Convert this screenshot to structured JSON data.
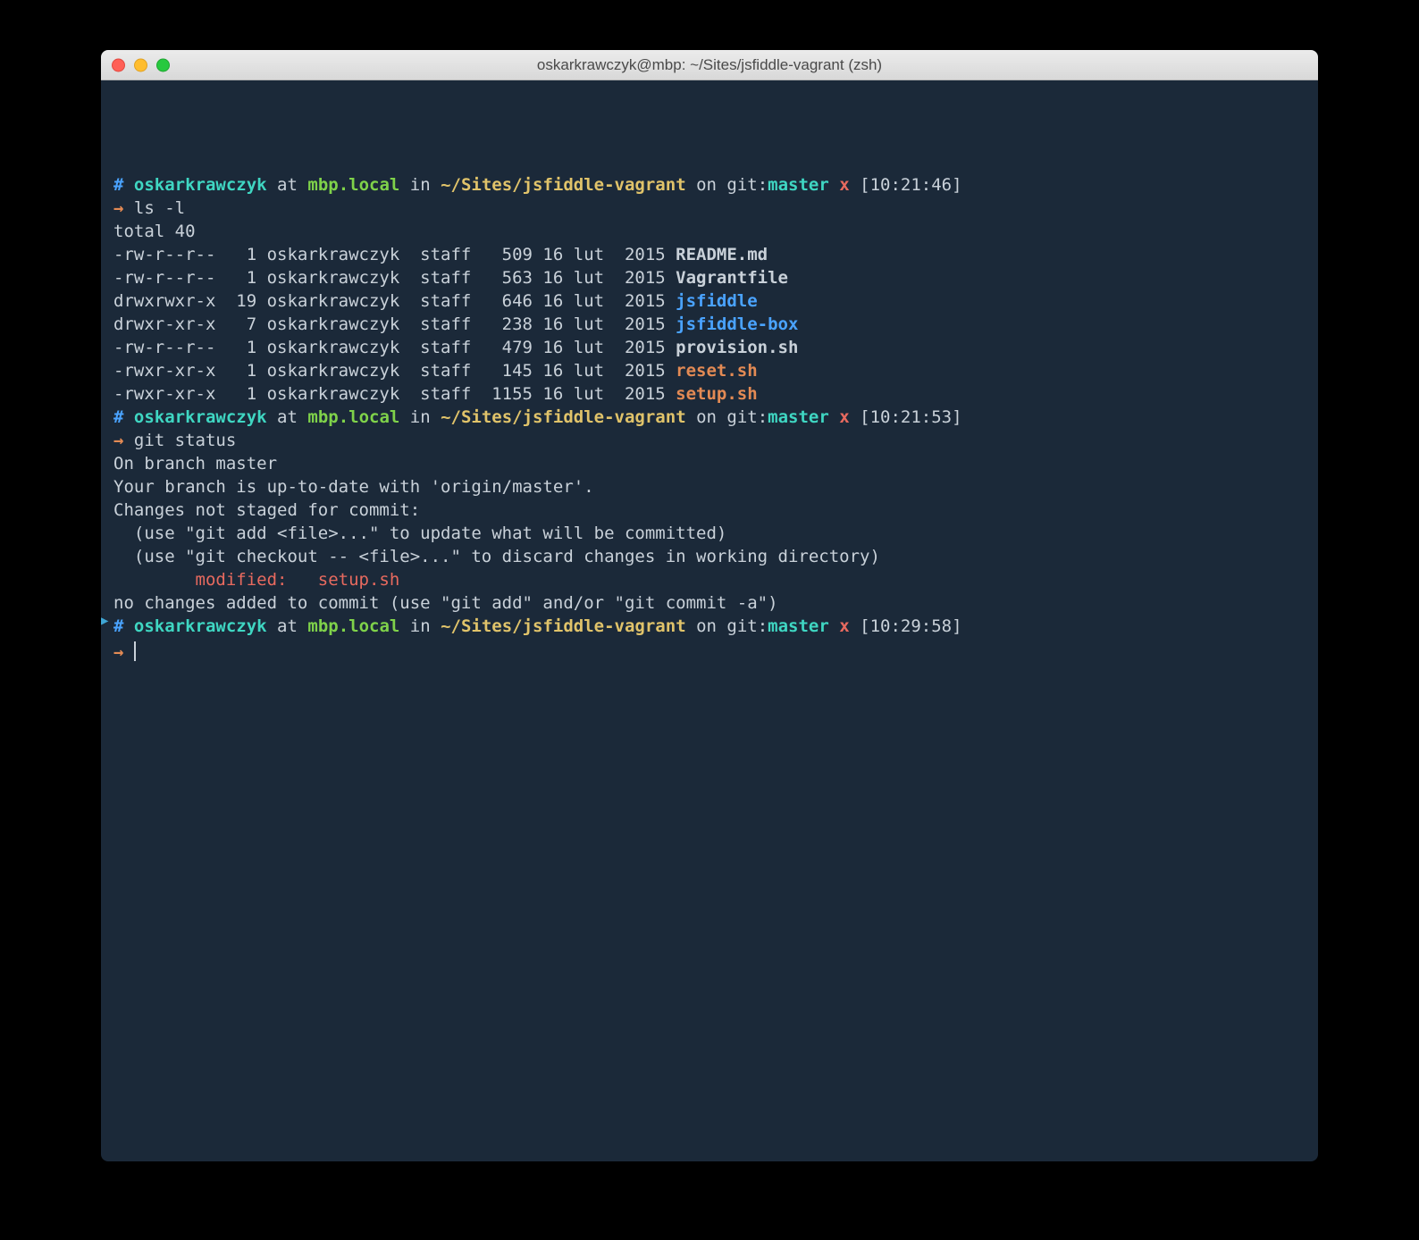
{
  "window": {
    "title": "oskarkrawczyk@mbp: ~/Sites/jsfiddle-vagrant (zsh)"
  },
  "prompts": [
    {
      "hash": "# ",
      "user": "oskarkrawczyk",
      "at_word": " at ",
      "host": "mbp.local",
      "in_word": " in ",
      "path": "~/Sites/jsfiddle-vagrant",
      "on_word": " on ",
      "git_prefix": "git:",
      "branch": "master",
      "dirty": " x ",
      "time": "[10:21:46]",
      "arrow": "→ ",
      "command": "ls -l"
    },
    {
      "hash": "# ",
      "user": "oskarkrawczyk",
      "at_word": " at ",
      "host": "mbp.local",
      "in_word": " in ",
      "path": "~/Sites/jsfiddle-vagrant",
      "on_word": " on ",
      "git_prefix": "git:",
      "branch": "master",
      "dirty": " x ",
      "time": "[10:21:53]",
      "arrow": "→ ",
      "command": "git status"
    },
    {
      "hash": "# ",
      "user": "oskarkrawczyk",
      "at_word": " at ",
      "host": "mbp.local",
      "in_word": " in ",
      "path": "~/Sites/jsfiddle-vagrant",
      "on_word": " on ",
      "git_prefix": "git:",
      "branch": "master",
      "dirty": " x ",
      "time": "[10:29:58]",
      "arrow": "→ ",
      "command": ""
    }
  ],
  "ls": {
    "total": "total 40",
    "rows": [
      {
        "perm": "-rw-r--r--   1 oskarkrawczyk  staff   509 16 lut  2015 ",
        "name": "README.md",
        "color": "white"
      },
      {
        "perm": "-rw-r--r--   1 oskarkrawczyk  staff   563 16 lut  2015 ",
        "name": "Vagrantfile",
        "color": "white"
      },
      {
        "perm": "drwxrwxr-x  19 oskarkrawczyk  staff   646 16 lut  2015 ",
        "name": "jsfiddle",
        "color": "blue"
      },
      {
        "perm": "drwxr-xr-x   7 oskarkrawczyk  staff   238 16 lut  2015 ",
        "name": "jsfiddle-box",
        "color": "blue"
      },
      {
        "perm": "-rw-r--r--   1 oskarkrawczyk  staff   479 16 lut  2015 ",
        "name": "provision.sh",
        "color": "white"
      },
      {
        "perm": "-rwxr-xr-x   1 oskarkrawczyk  staff   145 16 lut  2015 ",
        "name": "reset.sh",
        "color": "orange"
      },
      {
        "perm": "-rwxr-xr-x   1 oskarkrawczyk  staff  1155 16 lut  2015 ",
        "name": "setup.sh",
        "color": "orange"
      }
    ]
  },
  "git": {
    "on_branch": "On branch master",
    "uptodate": "Your branch is up-to-date with 'origin/master'.",
    "changes": "Changes not staged for commit:",
    "use_add": "  (use \"git add <file>...\" to update what will be committed)",
    "use_checkout": "  (use \"git checkout -- <file>...\" to discard changes in working directory)",
    "blank": "",
    "modified": "        modified:   setup.sh",
    "no_changes": "no changes added to commit (use \"git add\" and/or \"git commit -a\")"
  },
  "marker": "▶"
}
